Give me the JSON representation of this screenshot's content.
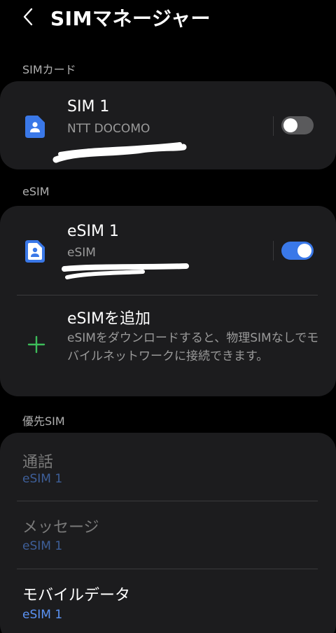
{
  "header": {
    "title": "SIMマネージャー"
  },
  "sections": {
    "sim_cards": "SIMカード",
    "esim": "eSIM",
    "preferred": "優先SIM"
  },
  "sim1": {
    "name": "SIM 1",
    "carrier": "NTT DOCOMO",
    "enabled": false
  },
  "esim1": {
    "name": "eSIM 1",
    "type": "eSIM",
    "enabled": true
  },
  "add_esim": {
    "title": "eSIMを追加",
    "description": "eSIMをダウンロードすると、物理SIMなしでモバイルネットワークに接続できます。"
  },
  "preferred": {
    "calls": {
      "label": "通話",
      "value": "eSIM 1"
    },
    "messages": {
      "label": "メッセージ",
      "value": "eSIM 1"
    },
    "mobile_data": {
      "label": "モバイルデータ",
      "value": "eSIM 1"
    }
  },
  "colors": {
    "background": "#000000",
    "card": "#1c1c1e",
    "accent": "#3a78e8",
    "sim_icon": "#3a78e8",
    "plus": "#3dbd5a"
  }
}
